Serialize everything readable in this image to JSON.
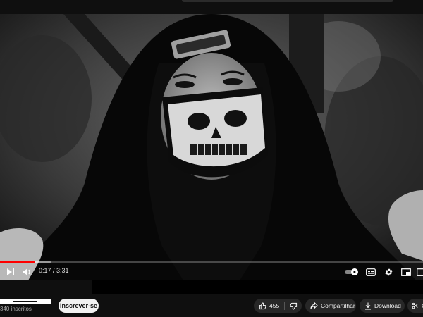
{
  "player": {
    "current_time": "0:17",
    "separator": " / ",
    "duration": "3:31",
    "progress_fraction": 0.081,
    "buffered_fraction": 0.12,
    "autoplay_on": true
  },
  "channel": {
    "subscribers": "340 inscritos",
    "subscribe_label": "Inscrever-se"
  },
  "actions": {
    "likes": "455",
    "share_label": "Compartilhar",
    "download_label": "Download",
    "clip_label": "C"
  },
  "colors": {
    "progress": "#ff0000",
    "page_bg": "#0f0f0f",
    "pill_bg": "#272727"
  }
}
